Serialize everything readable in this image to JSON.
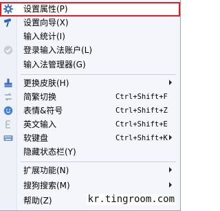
{
  "menu": {
    "items": [
      {
        "label": "设置属性(P)",
        "icon": "gear-icon"
      },
      {
        "label": "设置向导(X)",
        "icon": "wand-icon"
      },
      {
        "label": "输入统计(I)"
      },
      {
        "label": "登录输入法账户(L)",
        "icon": "account-icon"
      },
      {
        "label": "输入法管理器(G)"
      },
      {
        "label": "更换皮肤(H)",
        "icon": "brush-icon",
        "submenu": true
      },
      {
        "label": "简繁切换",
        "icon": "convert-icon",
        "shortcut": "Ctrl+Shift+F"
      },
      {
        "label": "表情&符号",
        "icon": "smiley-icon",
        "shortcut": "Ctrl+Shift+Z"
      },
      {
        "label": "英文输入",
        "icon": "english-icon",
        "shortcut": "Ctrl+Shift+E"
      },
      {
        "label": "软键盘",
        "icon": "keyboard-icon",
        "shortcut": "Ctrl+Shift+K",
        "submenu": true
      },
      {
        "label": "隐藏状态栏(Y)"
      },
      {
        "label": "扩展功能(N)",
        "submenu": true
      },
      {
        "label": "搜狗搜索(M)",
        "submenu": true
      },
      {
        "label": "帮助(Z)",
        "submenu": true
      }
    ]
  },
  "watermark": "kr.tingroom.com",
  "colors": {
    "highlight_border": "#e51c23",
    "menu_bg": "#f4f6fb"
  }
}
